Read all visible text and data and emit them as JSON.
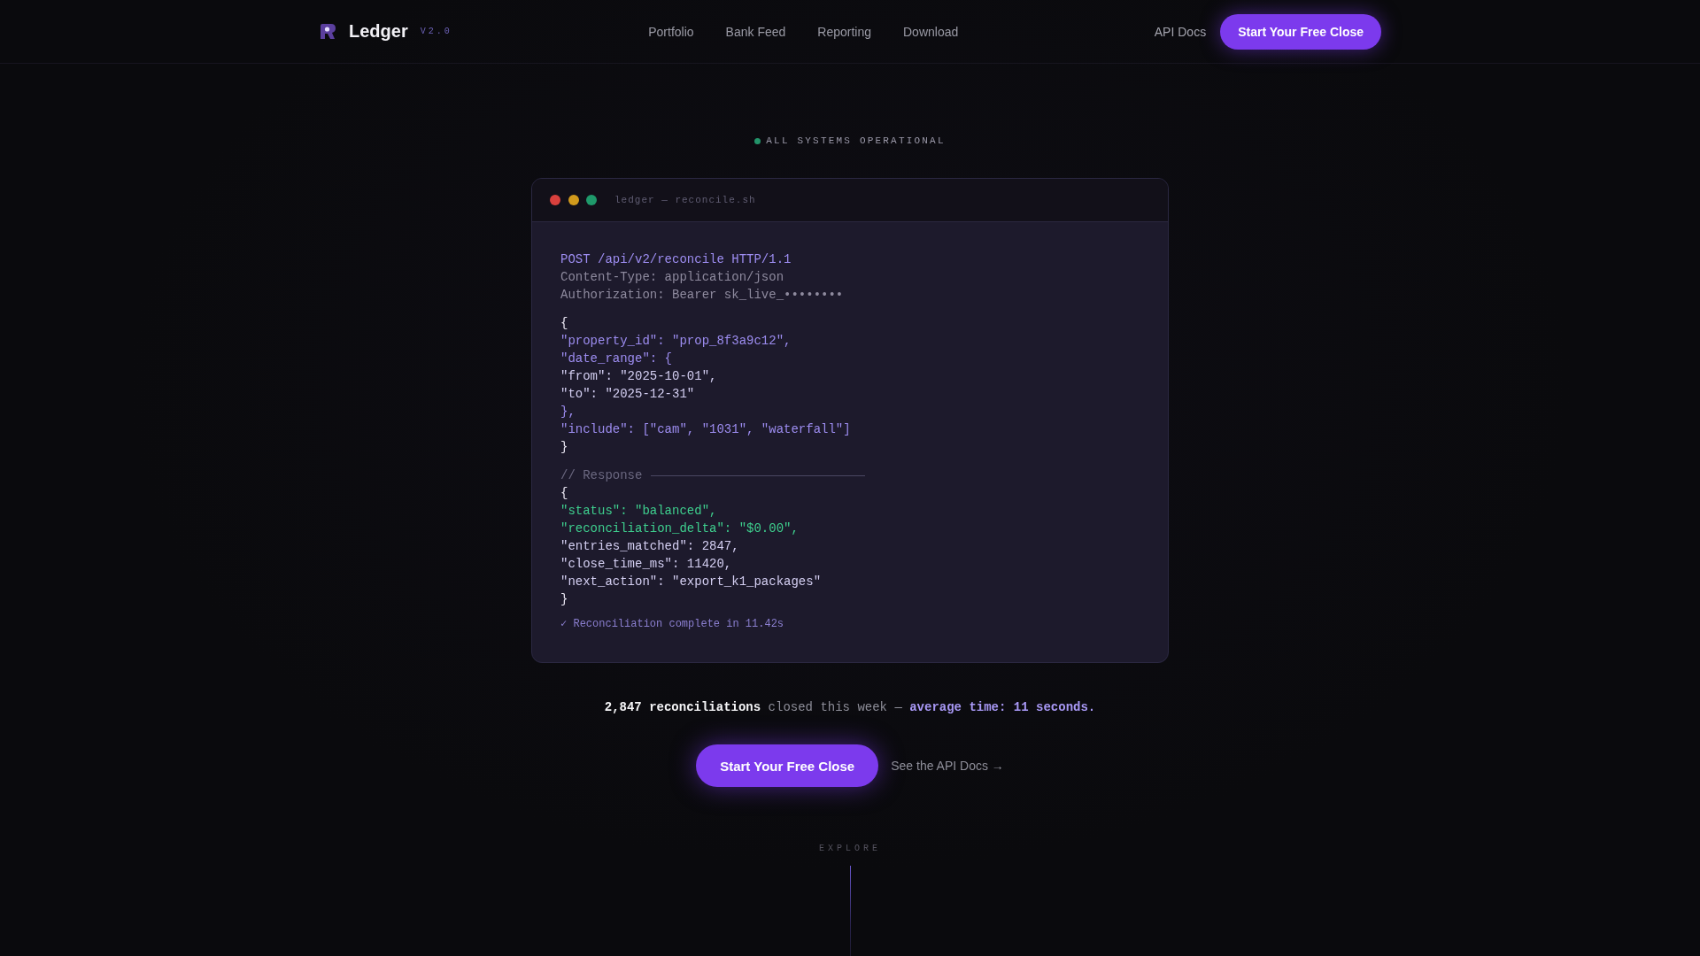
{
  "header": {
    "brand": "Ledger",
    "version": "V2.0",
    "nav": [
      {
        "label": "Portfolio"
      },
      {
        "label": "Bank Feed"
      },
      {
        "label": "Reporting"
      },
      {
        "label": "Download"
      }
    ],
    "docs_link": "API Docs",
    "cta": "Start Your Free Close"
  },
  "status": {
    "label": "ALL SYSTEMS OPERATIONAL",
    "color": "#23946a"
  },
  "terminal": {
    "title": "ledger — reconcile.sh",
    "blocks": [
      {
        "lines": [
          {
            "kind": "accent",
            "text": "POST /api/v2/reconcile HTTP/1.1"
          },
          {
            "kind": "meta",
            "text": "Content-Type: application/json"
          },
          {
            "kind": "meta",
            "text": "Authorization: Bearer sk_live_••••••••"
          }
        ]
      },
      {
        "lines": [
          {
            "kind": "brace",
            "text": "{"
          },
          {
            "kind": "accent",
            "text": "\"property_id\": \"prop_8f3a9c12\","
          },
          {
            "kind": "accent",
            "text": "\"date_range\": {"
          },
          {
            "kind": "value",
            "text": "\"from\": \"2025-10-01\","
          },
          {
            "kind": "value",
            "text": "\"to\": \"2025-12-31\""
          },
          {
            "kind": "accent",
            "text": "},"
          },
          {
            "kind": "accent",
            "text": "\"include\": [\"cam\", \"1031\", \"waterfall\"]"
          },
          {
            "kind": "brace",
            "text": "}"
          }
        ]
      },
      {
        "lines": [
          {
            "kind": "comment",
            "text": "// Response"
          },
          {
            "kind": "brace",
            "text": "{"
          },
          {
            "kind": "success",
            "text": "\"status\": \"balanced\","
          },
          {
            "kind": "success",
            "text": "\"reconciliation_delta\": \"$0.00\","
          },
          {
            "kind": "value",
            "text": "\"entries_matched\": 2847,"
          },
          {
            "kind": "value",
            "text": "\"close_time_ms\": 11420,"
          },
          {
            "kind": "value",
            "text": "\"next_action\": \"export_k1_packages\""
          },
          {
            "kind": "brace",
            "text": "}"
          }
        ]
      }
    ],
    "note": "✓ Reconciliation complete in 11.42s"
  },
  "summary": [
    {
      "kind": "count",
      "text": "2,847 reconciliations"
    },
    {
      "kind": "plain",
      "text": " closed this week — "
    },
    {
      "kind": "highlight",
      "text": "average time: 11 seconds."
    }
  ],
  "cta": {
    "primary": "Start Your Free Close",
    "secondary": "See the API Docs →"
  },
  "explore": {
    "label": "EXPLORE"
  }
}
